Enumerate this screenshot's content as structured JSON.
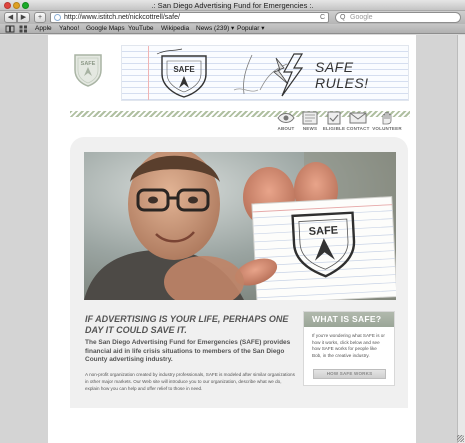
{
  "window": {
    "title": ".: San Diego Advertising Fund for Emergencies :."
  },
  "toolbar": {
    "back_glyph": "◀",
    "forward_glyph": "▶",
    "add_glyph": "+",
    "url": "http://www.istitch.net/nickcottrell/safe/",
    "reload_glyph": "C",
    "search_placeholder": "Google",
    "search_glyph": "Q"
  },
  "bookmarks": {
    "items": [
      "Apple",
      "Yahoo!",
      "Google Maps",
      "YouTube",
      "Wikipedia",
      "News (239) ▾",
      "Popular ▾"
    ]
  },
  "header": {
    "logo_text": "SAFE",
    "banner_text": "SAFE RULES!",
    "sketch_badge_text": "SAFE"
  },
  "nav": {
    "items": [
      {
        "label": "ABOUT",
        "icon": "eye-icon"
      },
      {
        "label": "NEWS",
        "icon": "newspaper-icon"
      },
      {
        "label": "ELIGIBLE",
        "icon": "checklist-icon"
      },
      {
        "label": "CONTACT",
        "icon": "envelope-icon"
      },
      {
        "label": "VOLUNTEER",
        "icon": "hand-icon"
      }
    ]
  },
  "hero": {
    "card_text": "SAFE"
  },
  "main": {
    "tagline": "If advertising is your life, perhaps one day it could save it.",
    "lead": "The San Diego Advertising Fund for Emergencies (SAFE) provides financial aid in life crisis situations to members of the San Diego County advertising industry.",
    "body": "A non-profit organization created by industry professionals, SAFE is modeled after similar organizations in other major markets. Our Web site will introduce you to our organization, describe what we do, explain how you can help and offer relief to those in need."
  },
  "sidebar": {
    "heading": "WHAT IS SAFE?",
    "text": "If you're wondering what SAFE is or how it works, click below and see how SAFE works for people like Bob, in the creative industry.",
    "button": "HOW SAFE WORKS"
  },
  "colors": {
    "accent_green": "#9aa597",
    "text_gray": "#555555",
    "page_bg": "#d4d4d4"
  }
}
